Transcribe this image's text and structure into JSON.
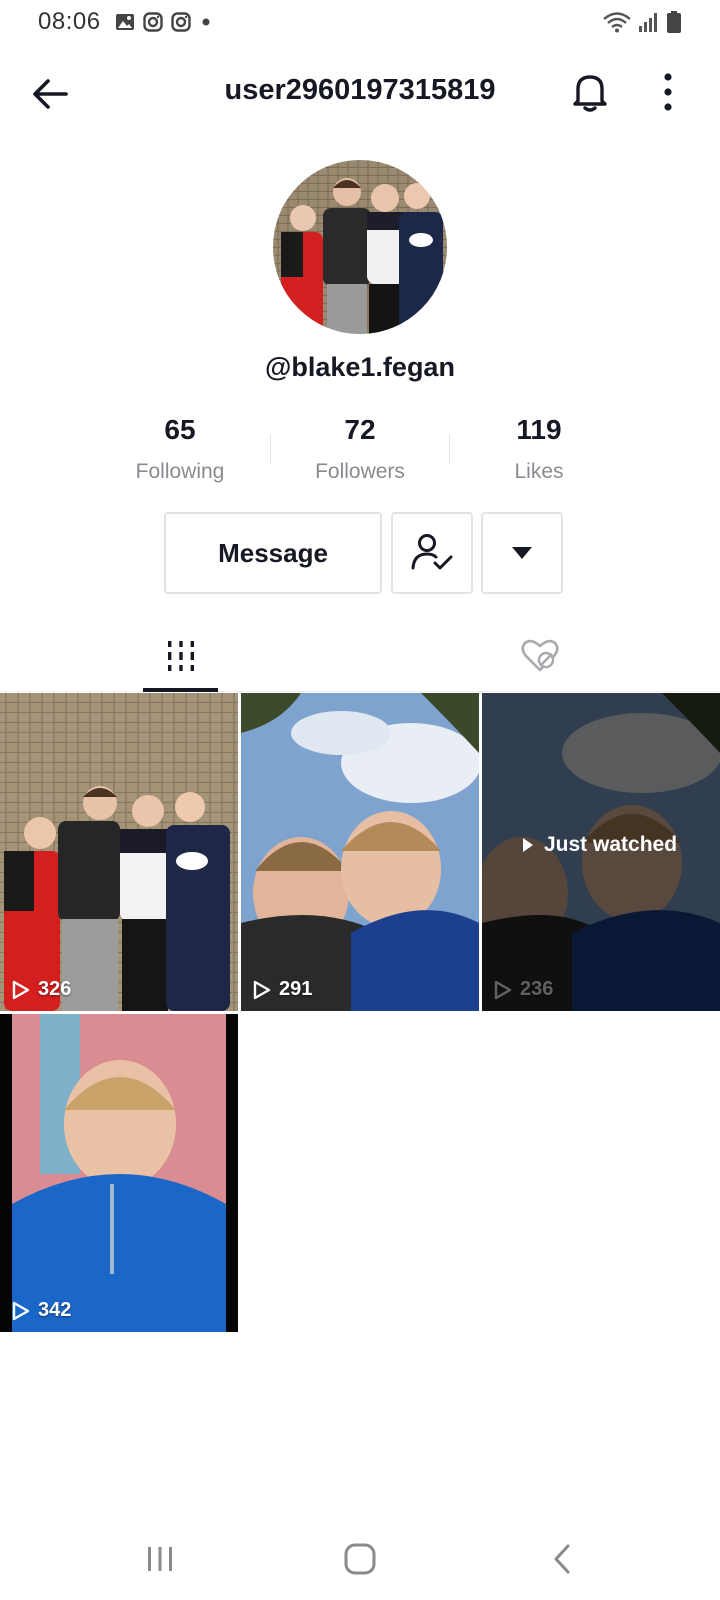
{
  "status_bar": {
    "time": "08:06",
    "left_icons": [
      "gallery-icon",
      "instagram-icon",
      "instagram-icon",
      "dot-icon"
    ],
    "right_icons": [
      "wifi-icon",
      "signal-icon",
      "battery-icon"
    ]
  },
  "header": {
    "title": "user2960197315819",
    "icons": [
      "back-arrow-icon",
      "bell-icon",
      "more-vertical-icon"
    ]
  },
  "profile": {
    "handle": "@blake1.fegan",
    "stats": [
      {
        "value": "65",
        "label": "Following"
      },
      {
        "value": "72",
        "label": "Followers"
      },
      {
        "value": "119",
        "label": "Likes"
      }
    ]
  },
  "actions": {
    "message_label": "Message",
    "friend_icon": "user-check-icon",
    "dropdown_icon": "caret-down-icon"
  },
  "tabs": [
    {
      "name": "videos",
      "icon": "grid-icon",
      "active": true
    },
    {
      "name": "liked",
      "icon": "heart-hidden-icon",
      "active": false
    }
  ],
  "videos": [
    {
      "views": "326"
    },
    {
      "views": "291"
    },
    {
      "views": "236",
      "overlay": "Just watched"
    },
    {
      "views": "342"
    }
  ],
  "nav": [
    "recents-icon",
    "home-icon",
    "back-icon"
  ],
  "colors": {
    "text": "#161823",
    "secondary": "#8a8b91",
    "border": "#e3e3e4"
  }
}
